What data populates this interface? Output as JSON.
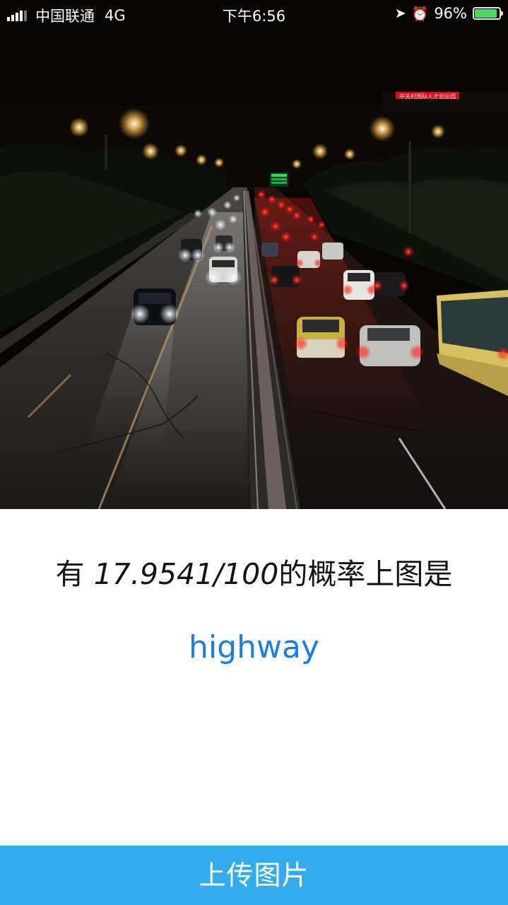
{
  "status_bar": {
    "carrier": "中国联通",
    "network": "4G",
    "time": "下午6:56",
    "battery_percent": "96%",
    "battery_level": 0.96,
    "battery_color": "#4cd964",
    "icons": [
      "signal-icon",
      "location-arrow-icon",
      "alarm-clock-icon",
      "battery-icon"
    ]
  },
  "photo": {
    "subject": "night-highway-photo",
    "sign_text": "中关村国际人才创业园"
  },
  "result": {
    "prefix": "有 ",
    "probability": "17.9541/100",
    "suffix": "的概率上图是",
    "label": "highway",
    "label_color": "#1a7ee3"
  },
  "upload_button": {
    "label": "上传图片",
    "color": "#35abeb"
  }
}
